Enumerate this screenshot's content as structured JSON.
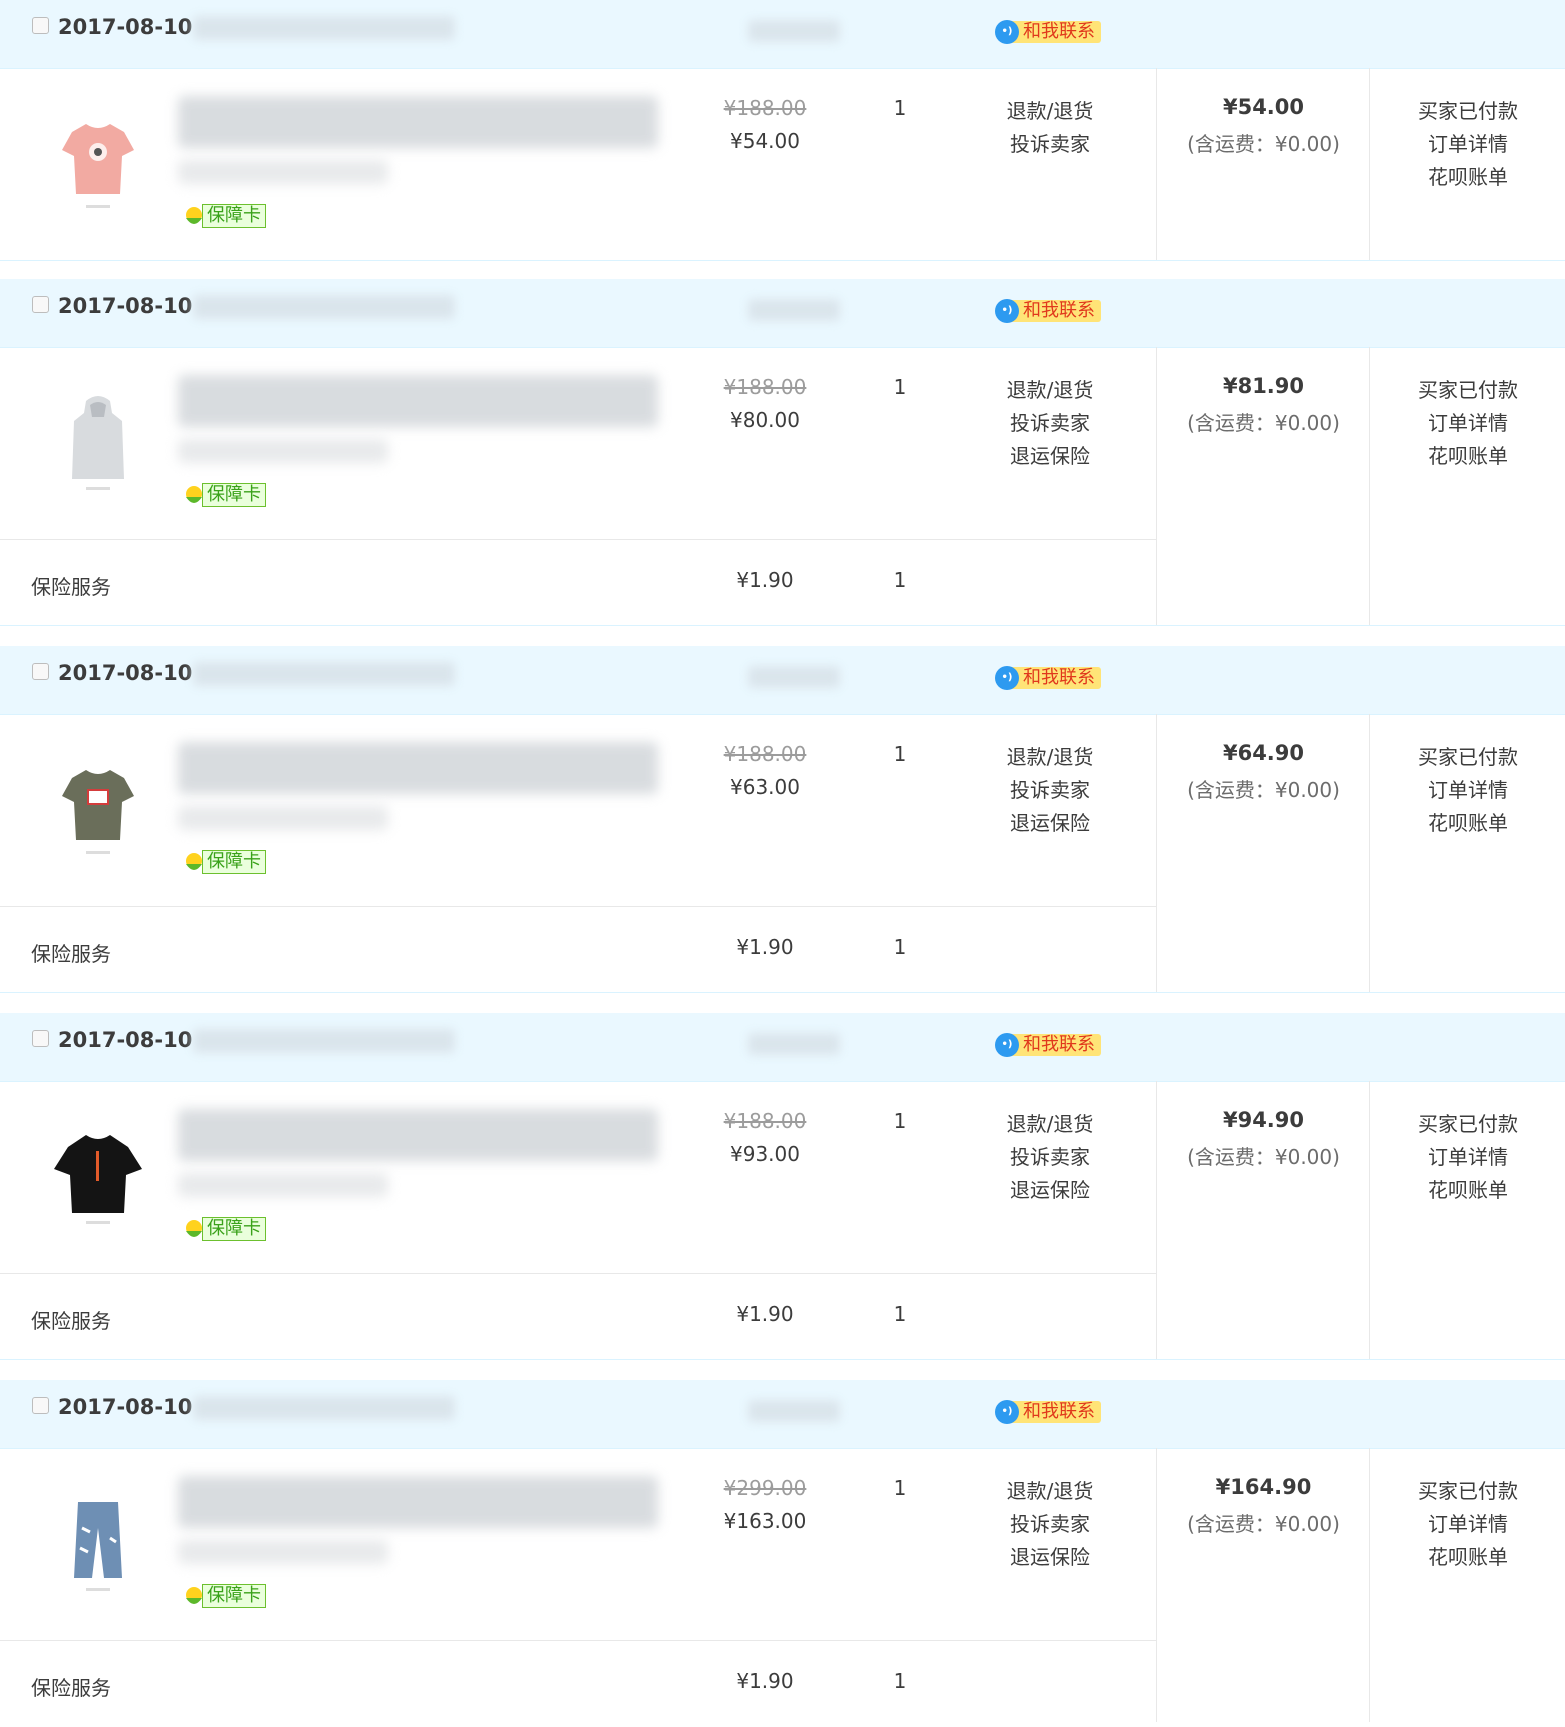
{
  "colors": {
    "header_bg": "#eaf8ff",
    "contact_badge_bg": "#ffe477",
    "contact_text": "#e0381c",
    "guarantee_green": "#3aa21a",
    "bubble_blue": "#2d9af0"
  },
  "orders": [
    {
      "date": "2017-08-10",
      "contact_label": "和我联系",
      "item": {
        "thumb_icon": "pink-tshirt-icon",
        "guarantee_label": "保障卡",
        "original_price": "¥188.00",
        "price": "¥54.00",
        "quantity": "1",
        "actions": [
          "退款/退货",
          "投诉卖家"
        ]
      },
      "insurance": null,
      "total": "¥54.00",
      "shipping": "(含运费：¥0.00)",
      "status": [
        "买家已付款",
        "订单详情",
        "花呗账单"
      ]
    },
    {
      "date": "2017-08-10",
      "contact_label": "和我联系",
      "item": {
        "thumb_icon": "grey-hoodie-vest-icon",
        "guarantee_label": "保障卡",
        "original_price": "¥188.00",
        "price": "¥80.00",
        "quantity": "1",
        "actions": [
          "退款/退货",
          "投诉卖家",
          "退运保险"
        ]
      },
      "insurance": {
        "label": "保险服务",
        "price": "¥1.90",
        "quantity": "1"
      },
      "total": "¥81.90",
      "shipping": "(含运费：¥0.00)",
      "status": [
        "买家已付款",
        "订单详情",
        "花呗账单"
      ]
    },
    {
      "date": "2017-08-10",
      "contact_label": "和我联系",
      "item": {
        "thumb_icon": "olive-tshirt-icon",
        "guarantee_label": "保障卡",
        "original_price": "¥188.00",
        "price": "¥63.00",
        "quantity": "1",
        "actions": [
          "退款/退货",
          "投诉卖家",
          "退运保险"
        ]
      },
      "insurance": {
        "label": "保险服务",
        "price": "¥1.90",
        "quantity": "1"
      },
      "total": "¥64.90",
      "shipping": "(含运费：¥0.00)",
      "status": [
        "买家已付款",
        "订单详情",
        "花呗账单"
      ]
    },
    {
      "date": "2017-08-10",
      "contact_label": "和我联系",
      "item": {
        "thumb_icon": "black-tshirt-icon",
        "guarantee_label": "保障卡",
        "original_price": "¥188.00",
        "price": "¥93.00",
        "quantity": "1",
        "actions": [
          "退款/退货",
          "投诉卖家",
          "退运保险"
        ]
      },
      "insurance": {
        "label": "保险服务",
        "price": "¥1.90",
        "quantity": "1"
      },
      "total": "¥94.90",
      "shipping": "(含运费：¥0.00)",
      "status": [
        "买家已付款",
        "订单详情",
        "花呗账单"
      ]
    },
    {
      "date": "2017-08-10",
      "contact_label": "和我联系",
      "item": {
        "thumb_icon": "jeans-icon",
        "guarantee_label": "保障卡",
        "original_price": "¥299.00",
        "price": "¥163.00",
        "quantity": "1",
        "actions": [
          "退款/退货",
          "投诉卖家",
          "退运保险"
        ]
      },
      "insurance": {
        "label": "保险服务",
        "price": "¥1.90",
        "quantity": "1"
      },
      "total": "¥164.90",
      "shipping": "(含运费：¥0.00)",
      "status": [
        "买家已付款",
        "订单详情",
        "花呗账单"
      ]
    }
  ]
}
